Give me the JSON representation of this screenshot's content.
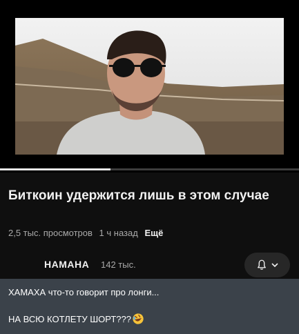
{
  "video": {
    "progress_fraction": 0.37
  },
  "title": "Биткоин удержится лишь в этом случае",
  "meta": {
    "views": "2,5 тыс. просмотров",
    "age": "1 ч назад",
    "more": "Ещё"
  },
  "channel": {
    "name": "НАМАНА",
    "subscribers": "142 тыс.",
    "bell_icon": "bell-icon",
    "chevron_icon": "chevron-down-icon"
  },
  "comment": {
    "line1": "ХАМАХА что-то говорит про лонги...",
    "line2": "НА ВСЮ КОТЛЕТУ ШОРТ???",
    "emoji": "rofl-emoji"
  },
  "colors": {
    "background": "#0f0f0f",
    "comment_bg": "#3b424a",
    "progress": "#e8e8e8",
    "secondary_text": "#aaaaaa"
  }
}
